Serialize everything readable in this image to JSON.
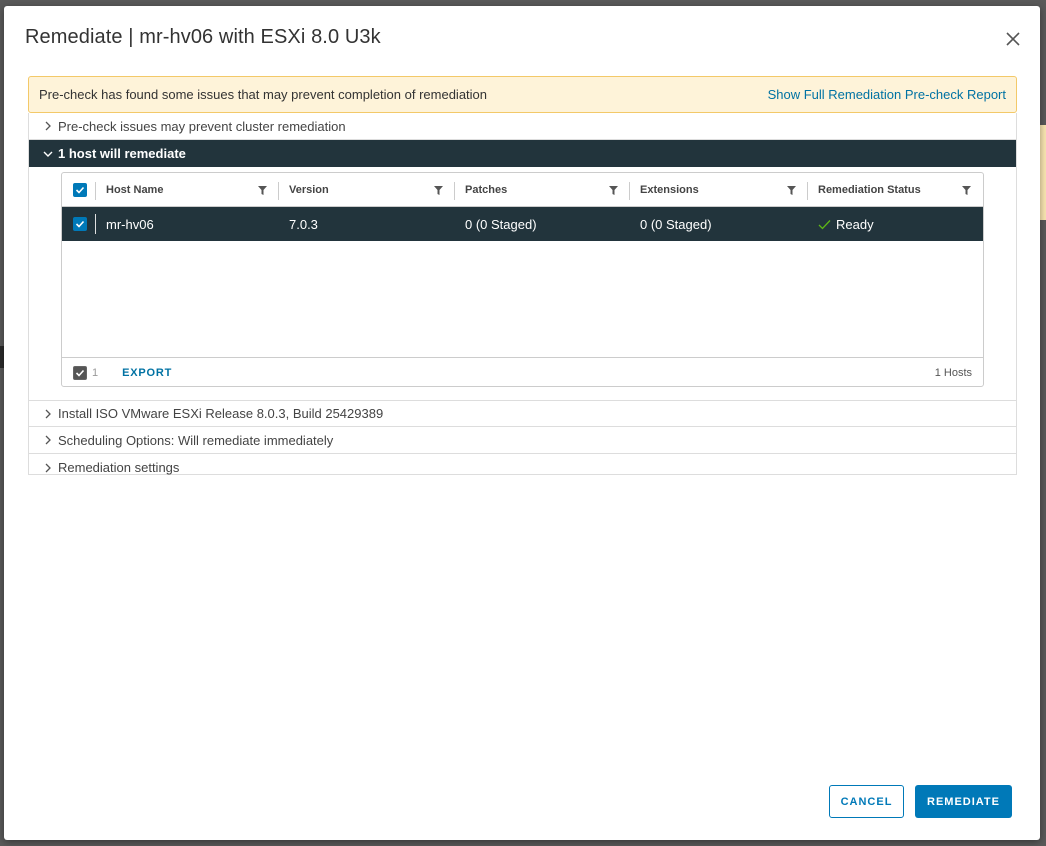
{
  "modal": {
    "title": "Remediate | mr-hv06 with ESXi 8.0 U3k"
  },
  "alert": {
    "message": "Pre-check has found some issues that may prevent completion of remediation",
    "link": "Show Full Remediation Pre-check Report",
    "color": "#fef3d9"
  },
  "sections": {
    "precheck": "Pre-check issues may prevent cluster remediation",
    "hosts": "1 host will remediate",
    "install": "Install ISO VMware ESXi Release 8.0.3, Build 25429389",
    "scheduling": "Scheduling Options: Will remediate immediately",
    "settings": "Remediation settings"
  },
  "grid": {
    "columns": [
      "Host Name",
      "Version",
      "Patches",
      "Extensions",
      "Remediation Status"
    ],
    "rows": [
      {
        "host": "mr-hv06",
        "version": "7.0.3",
        "patches": "0 (0 Staged)",
        "extensions": "0 (0 Staged)",
        "status": "Ready",
        "selected": true
      }
    ],
    "footer": {
      "selected_count": "1",
      "export": "EXPORT",
      "total": "1 Hosts"
    }
  },
  "buttons": {
    "cancel": "CANCEL",
    "remediate": "REMEDIATE"
  },
  "colors": {
    "accent": "#0079b8",
    "dark_row": "#22343c",
    "success": "#5eb715"
  }
}
